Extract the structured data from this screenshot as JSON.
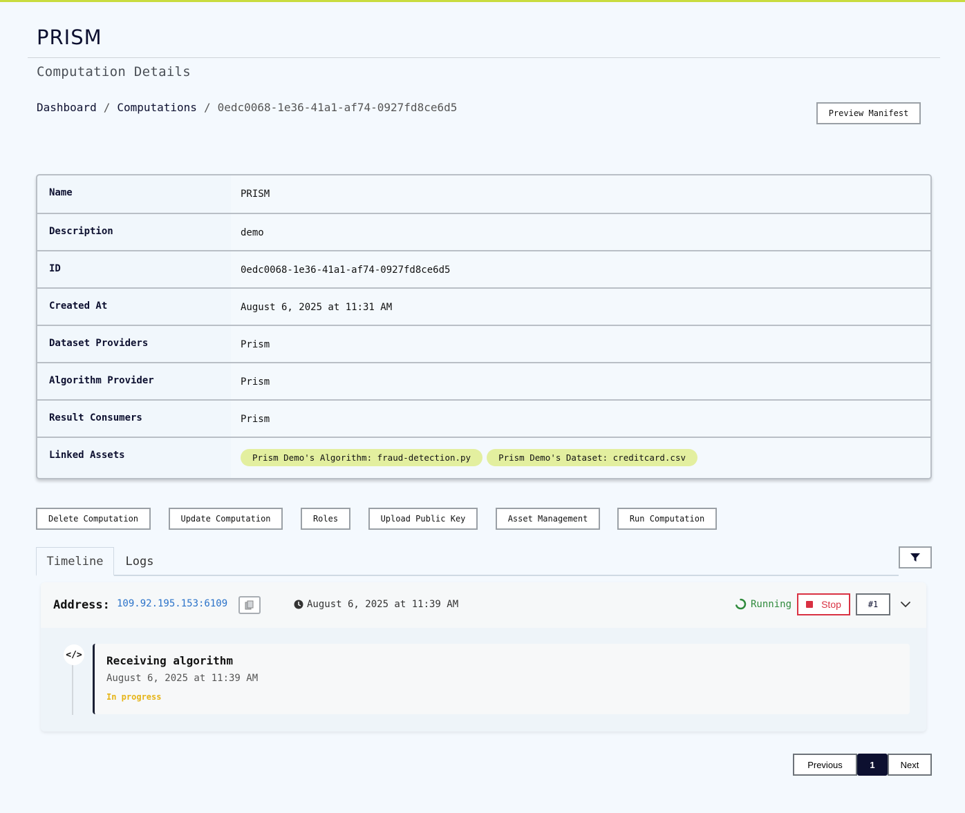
{
  "app": {
    "name": "PRISM"
  },
  "page": {
    "title": "Computation Details"
  },
  "breadcrumb": {
    "items": [
      "Dashboard",
      "Computations"
    ],
    "separator": "/",
    "current": "0edc0068-1e36-41a1-af74-0927fd8ce6d5"
  },
  "header": {
    "preview_manifest_label": "Preview Manifest"
  },
  "details": {
    "rows": [
      {
        "label": "Name",
        "value": "PRISM"
      },
      {
        "label": "Description",
        "value": "demo"
      },
      {
        "label": "ID",
        "value": "0edc0068-1e36-41a1-af74-0927fd8ce6d5"
      },
      {
        "label": "Created At",
        "value": "August 6, 2025 at 11:31 AM"
      },
      {
        "label": "Dataset Providers",
        "value": "Prism"
      },
      {
        "label": "Algorithm Provider",
        "value": "Prism"
      },
      {
        "label": "Result Consumers",
        "value": "Prism"
      },
      {
        "label": "Linked Assets",
        "value": ""
      }
    ],
    "linked_assets": [
      "Prism Demo's Algorithm: fraud-detection.py",
      "Prism Demo's Dataset: creditcard.csv"
    ]
  },
  "actions": {
    "delete": "Delete Computation",
    "update": "Update Computation",
    "roles": "Roles",
    "upload_key": "Upload Public Key",
    "asset_management": "Asset Management",
    "run": "Run Computation"
  },
  "tabs": {
    "timeline": "Timeline",
    "logs": "Logs",
    "active": "Timeline"
  },
  "run_panel": {
    "address_label": "Address:",
    "address": "109.92.195.153:6109",
    "timestamp": "August 6, 2025 at 11:39 AM",
    "status": "Running",
    "stop_label": "Stop",
    "run_number": "#1",
    "events": [
      {
        "icon": "code-icon",
        "title": "Receiving algorithm",
        "date": "August 6, 2025 at 11:39 AM",
        "status": "In progress"
      }
    ]
  },
  "pagination": {
    "previous": "Previous",
    "current": "1",
    "next": "Next"
  },
  "colors": {
    "accent_bar": "#c9dc3f",
    "navy": "#0d1030",
    "pill_bg": "#e3ef9f",
    "running_green": "#2f8a3c",
    "stop_red": "#d93142",
    "link_blue": "#2a72c9",
    "in_progress_yellow": "#e6b417"
  }
}
